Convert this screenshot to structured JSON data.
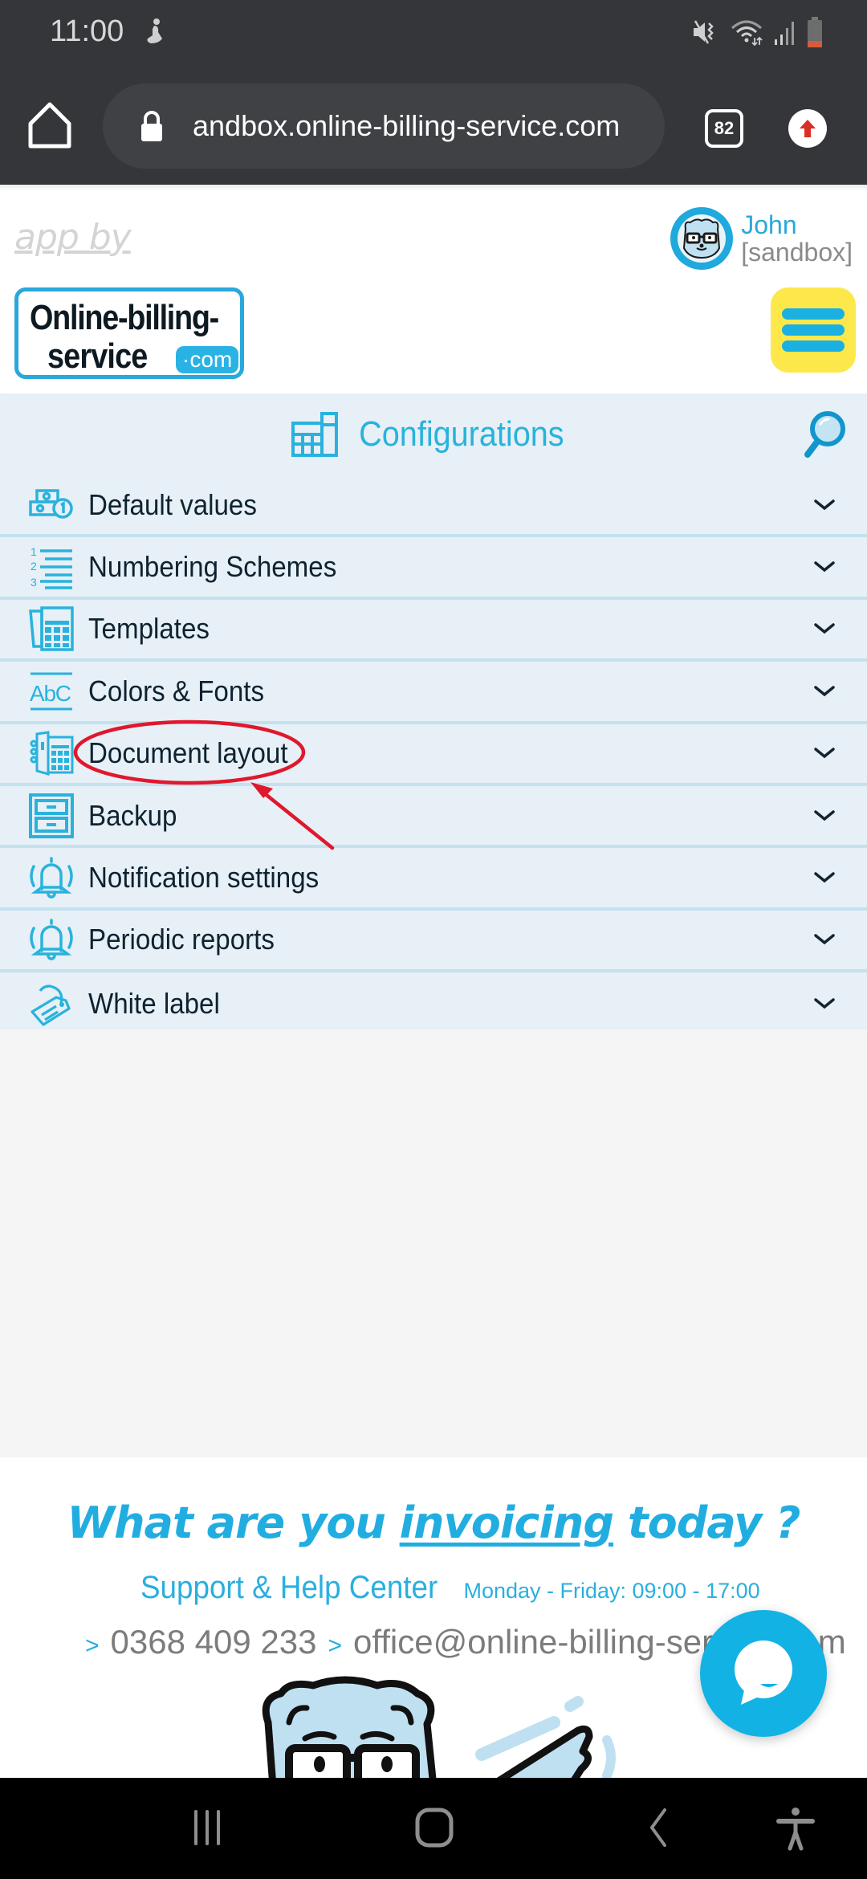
{
  "status_bar": {
    "time": "11:00",
    "icons": [
      "accessibility-person-icon",
      "mute-vibrate-icon",
      "wifi-icon",
      "signal-icon",
      "battery-low-icon"
    ]
  },
  "browser": {
    "url": "andbox.online-billing-service.com",
    "tab_count": "82",
    "home_icon": "home-icon",
    "lock_icon": "lock-icon",
    "update_icon": "update-arrow-icon"
  },
  "header": {
    "app_by": "app by",
    "logo_line1": "Online-billing-",
    "logo_line2": "service",
    "logo_suffix": "·com",
    "user_name": "John",
    "user_env": "[sandbox]",
    "menu_icon": "hamburger-menu-icon"
  },
  "config": {
    "title": "Configurations",
    "title_icon": "grid-configurations-icon",
    "search_icon": "magnifier-search-icon",
    "items": [
      {
        "label": "Default values",
        "icon": "money-coins-icon"
      },
      {
        "label": "Numbering Schemes",
        "icon": "numbered-list-icon"
      },
      {
        "label": "Templates",
        "icon": "template-calculator-icon"
      },
      {
        "label": "Colors & Fonts",
        "icon": "abc-text-icon"
      },
      {
        "label": "Document layout",
        "icon": "document-layout-icon",
        "highlighted": true
      },
      {
        "label": "Backup",
        "icon": "file-cabinet-icon"
      },
      {
        "label": "Notification settings",
        "icon": "bell-icon"
      },
      {
        "label": "Periodic reports",
        "icon": "bell-icon"
      },
      {
        "label": "White label",
        "icon": "tag-label-icon"
      }
    ]
  },
  "annotation": {
    "target": "Document layout",
    "color": "#e0172d"
  },
  "footer": {
    "tagline_pre": "What are you ",
    "tagline_em": "invoicing",
    "tagline_post": " today ?",
    "support_title": "Support & Help Center",
    "support_hours": "Monday - Friday: 09:00 - 17:00",
    "phone": "0368 409 233",
    "email": "office@online-billing-service.com",
    "arrow": ">"
  },
  "chat": {
    "icon": "chat-bubble-icon"
  },
  "nav_bar": {
    "buttons": [
      "recent-apps-icon",
      "home-circle-icon",
      "back-icon",
      "accessibility-icon"
    ]
  },
  "colors": {
    "accent": "#29b2dd",
    "panel_bg": "#e6f0f6",
    "divider": "#c3e1ef",
    "menu_button": "#fde84b",
    "text_dark": "#0f2230",
    "browser_chrome": "#35363a"
  }
}
